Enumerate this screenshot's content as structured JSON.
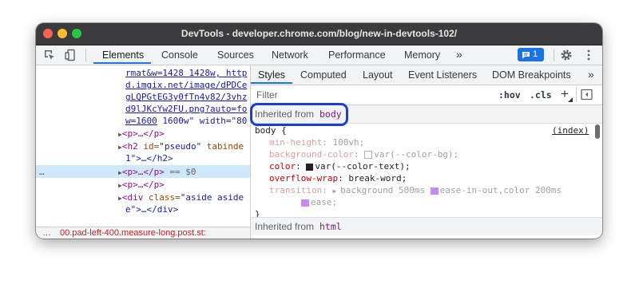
{
  "window": {
    "title": "DevTools - developer.chrome.com/blog/new-in-devtools-102/"
  },
  "toolbar": {
    "tabs": [
      "Elements",
      "Console",
      "Sources",
      "Network",
      "Performance",
      "Memory"
    ],
    "more_label": "»",
    "issues_count": "1",
    "icons": [
      "inspect-icon",
      "device-icon",
      "issues-icon",
      "gear-icon",
      "kebab-menu-icon"
    ]
  },
  "elements": {
    "lines": [
      {
        "text": "rmat&w=1428 1428w, http"
      },
      {
        "text": "d.imgix.net/image/dPDCe"
      },
      {
        "text": "gLQPGtEG3y0fTn4v82/3vhz"
      },
      {
        "text": "d9lJKcYw2FU.png?auto=fo"
      }
    ],
    "line5_link": "w=1600",
    "line5_rest": " 1600w\" width=\"80",
    "p1": "<p>…</p>",
    "h2_open": "<h2 ",
    "h2_attr": "id=",
    "h2_val": "\"pseudo\"",
    "h2_attr2": " tabinde",
    "h2_line2": "1\">…</h2>",
    "p_selected": "<p>…</p>",
    "selected_suffix": " == $0",
    "p3": "<p>…</p>",
    "div_open": "<div ",
    "div_attr": "class=",
    "div_val": "\"aside aside",
    "div_line2": "e\">…</div>",
    "ellipsis": "…"
  },
  "breadcrumb": {
    "ellipsis": "…",
    "path": "00.pad-left-400.measure-long.post.st:"
  },
  "sidebar": {
    "tabs": [
      "Styles",
      "Computed",
      "Layout",
      "Event Listeners",
      "DOM Breakpoints"
    ],
    "more_label": "»",
    "filter_placeholder": "Filter",
    "hov_label": ":hov",
    "cls_label": ".cls",
    "add_label": "+",
    "inherited_label": "Inherited from ",
    "inherited_tag": "body",
    "selector": "body {",
    "source": "(index)",
    "props": [
      {
        "name": "min-height",
        "value": "100vh",
        "overridden": true
      },
      {
        "name": "background-color",
        "value": "var(--color-bg)",
        "overridden": true
      },
      {
        "name": "color",
        "value": "var(--color-text)",
        "overridden": false
      },
      {
        "name": "overflow-wrap",
        "value": "break-word",
        "overridden": false
      },
      {
        "name": "transition",
        "value": "background 500ms ",
        "overridden": true
      }
    ],
    "transition_easing1": "ease-in-out",
    "transition_more": ",color 200ms",
    "transition_easing2": "ease",
    "close_brace": "}",
    "inherited2_label": "Inherited from ",
    "inherited2_tag": "html"
  },
  "colors": {
    "accent": "#1a73e8",
    "highlight_ring": "#1a3ecf",
    "text_color_swatch": "#202124",
    "bg_swatch": "#ffffff"
  }
}
